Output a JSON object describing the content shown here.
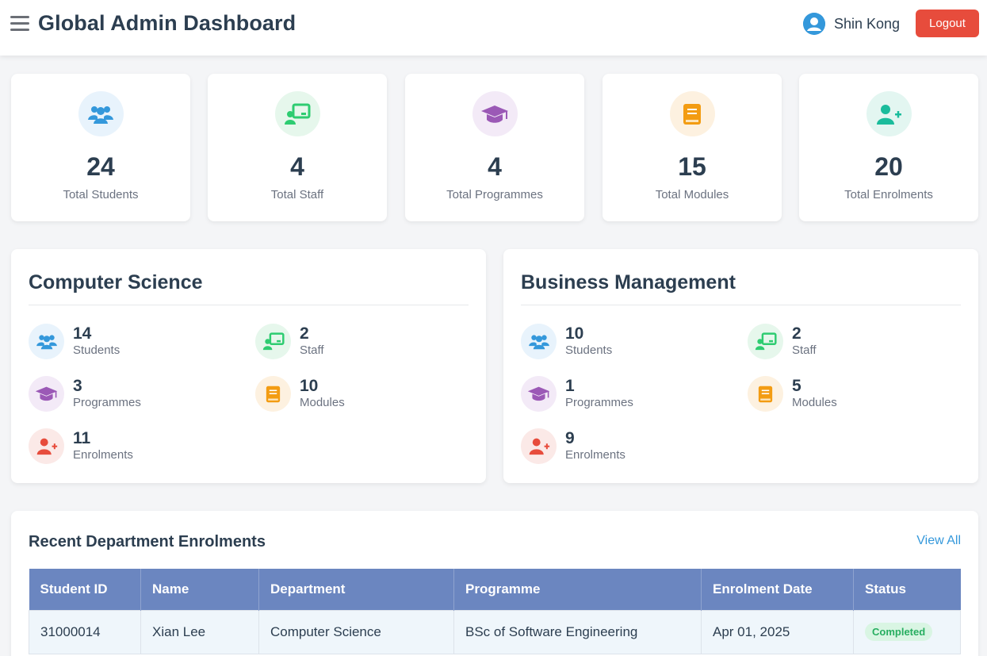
{
  "header": {
    "title": "Global Admin Dashboard",
    "user_name": "Shin Kong",
    "logout_label": "Logout"
  },
  "stats": [
    {
      "value": "24",
      "label": "Total Students",
      "icon": "users-icon",
      "color": "#3498db"
    },
    {
      "value": "4",
      "label": "Total Staff",
      "icon": "teacher-icon",
      "color": "#2ecc71"
    },
    {
      "value": "4",
      "label": "Total Programmes",
      "icon": "graduation-cap-icon",
      "color": "#9b59b6"
    },
    {
      "value": "15",
      "label": "Total Modules",
      "icon": "book-icon",
      "color": "#f39c12"
    },
    {
      "value": "20",
      "label": "Total Enrolments",
      "icon": "user-plus-icon",
      "color": "#1abc9c"
    }
  ],
  "departments": [
    {
      "name": "Computer Science",
      "students": {
        "value": "14",
        "label": "Students"
      },
      "staff": {
        "value": "2",
        "label": "Staff"
      },
      "programmes": {
        "value": "3",
        "label": "Programmes"
      },
      "modules": {
        "value": "10",
        "label": "Modules"
      },
      "enrolments": {
        "value": "11",
        "label": "Enrolments"
      }
    },
    {
      "name": "Business Management",
      "students": {
        "value": "10",
        "label": "Students"
      },
      "staff": {
        "value": "2",
        "label": "Staff"
      },
      "programmes": {
        "value": "1",
        "label": "Programmes"
      },
      "modules": {
        "value": "5",
        "label": "Modules"
      },
      "enrolments": {
        "value": "9",
        "label": "Enrolments"
      }
    }
  ],
  "recent": {
    "title": "Recent Department Enrolments",
    "view_all": "View All",
    "columns": [
      "Student ID",
      "Name",
      "Department",
      "Programme",
      "Enrolment Date",
      "Status"
    ],
    "rows": [
      {
        "student_id": "31000014",
        "name": "Xian Lee",
        "department": "Computer Science",
        "programme": "BSc of Software Engineering",
        "date": "Apr 01, 2025",
        "status": "Completed"
      }
    ]
  },
  "colors": {
    "accent": "#3498db",
    "logout": "#e74c3c",
    "table_header": "#6b86c0",
    "status_completed": "#27ae60"
  }
}
